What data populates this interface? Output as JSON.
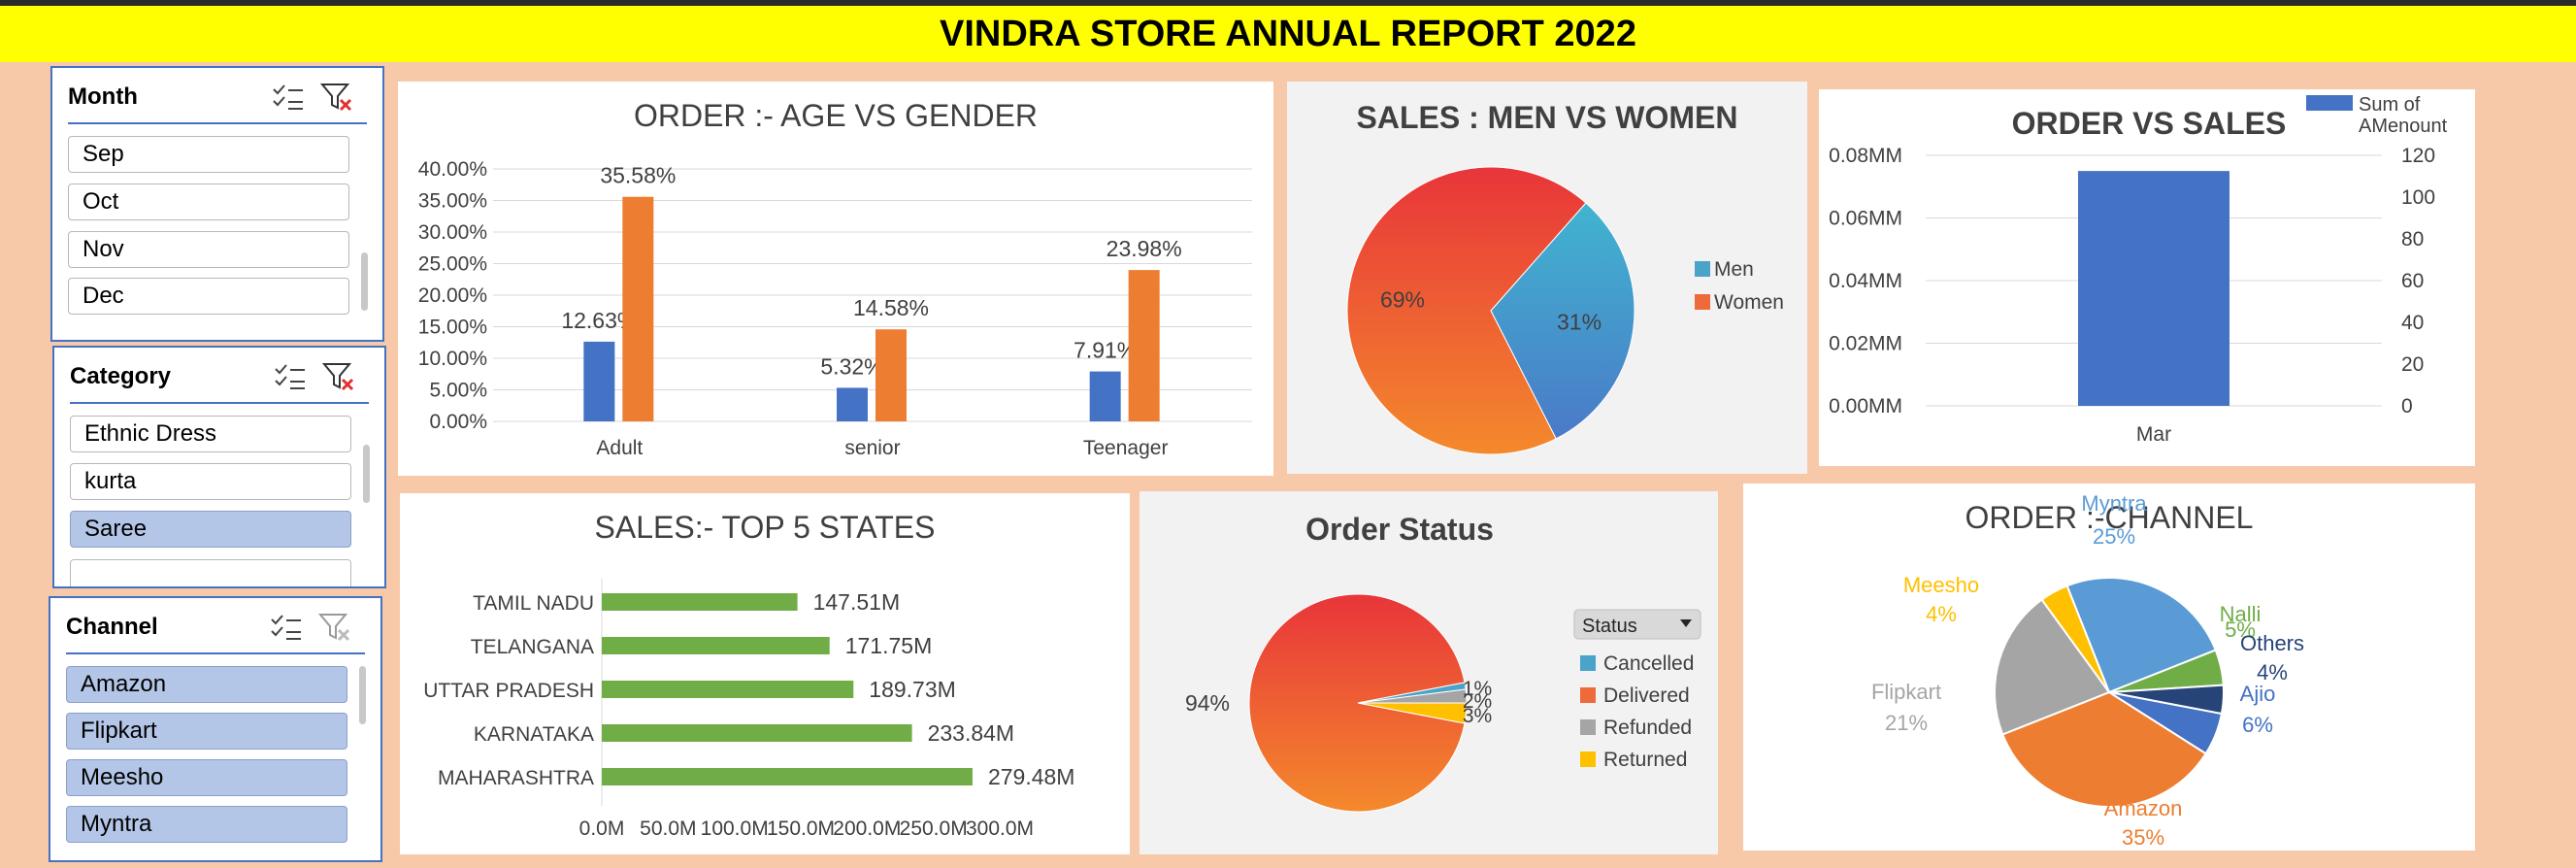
{
  "report": {
    "title": "VINDRA STORE ANNUAL REPORT 2022"
  },
  "slicers": {
    "month": {
      "title": "Month",
      "items": [
        {
          "label": "Sep",
          "selected": false
        },
        {
          "label": "Oct",
          "selected": false
        },
        {
          "label": "Nov",
          "selected": false
        },
        {
          "label": "Dec",
          "selected": false
        }
      ]
    },
    "category": {
      "title": "Category",
      "items": [
        {
          "label": "Ethnic Dress",
          "selected": false
        },
        {
          "label": "kurta",
          "selected": false
        },
        {
          "label": "Saree",
          "selected": true
        }
      ]
    },
    "channel": {
      "title": "Channel",
      "items": [
        {
          "label": "Amazon",
          "selected": true
        },
        {
          "label": "Flipkart",
          "selected": true
        },
        {
          "label": "Meesho",
          "selected": true
        },
        {
          "label": "Myntra",
          "selected": true
        }
      ]
    }
  },
  "icons": {
    "multiselect": "multi-select-icon",
    "clear_filter": "clear-filter-icon"
  },
  "colors": {
    "blue": "#4472c4",
    "orange": "#ed7d31",
    "green": "#70ad47",
    "grey": "#a5a5a5",
    "yellow": "#ffc000",
    "banner": "#ffff00",
    "background": "#f7c9a8"
  },
  "chart_data": [
    {
      "id": "age_gender",
      "type": "bar",
      "title": "ORDER :- AGE VS GENDER",
      "categories": [
        "Adult",
        "senior",
        "Teenager"
      ],
      "series": [
        {
          "values": [
            12.63,
            5.32,
            7.91
          ],
          "labels": [
            "12.63%",
            "5.32%",
            "7.91%"
          ],
          "color": "#4472c4"
        },
        {
          "values": [
            35.58,
            14.58,
            23.98
          ],
          "labels": [
            "35.58%",
            "14.58%",
            "23.98%"
          ],
          "color": "#ed7d31"
        }
      ],
      "ylim": [
        0,
        40
      ],
      "yticks": [
        "0.00%",
        "5.00%",
        "10.00%",
        "15.00%",
        "20.00%",
        "25.00%",
        "30.00%",
        "35.00%",
        "40.00%"
      ],
      "grid": true
    },
    {
      "id": "men_women",
      "type": "pie",
      "title": "SALES : MEN VS WOMEN",
      "labels": [
        "Men",
        "Women"
      ],
      "values": [
        31,
        69
      ],
      "value_labels": [
        "31%",
        "69%"
      ],
      "colors": [
        "#4aa3c8",
        "#ee6a3a"
      ],
      "legend": "right"
    },
    {
      "id": "order_sales",
      "type": "bar",
      "title": "ORDER VS SALES",
      "categories": [
        "Mar"
      ],
      "series": [
        {
          "name": "Sum of AMenount",
          "values": [
            0.075
          ],
          "color": "#4472c4"
        }
      ],
      "legend_lines": [
        "Sum of",
        "AMenount"
      ],
      "yticks": [
        "0.00MM",
        "0.02MM",
        "0.04MM",
        "0.06MM",
        "0.08MM"
      ],
      "ylim": [
        0,
        0.08
      ],
      "y2ticks": [
        "0",
        "20",
        "40",
        "60",
        "80",
        "100",
        "120"
      ],
      "y2lim": [
        0,
        120
      ],
      "legend": "top-right"
    },
    {
      "id": "top_states",
      "type": "bar",
      "orientation": "horizontal",
      "title": "SALES:- TOP 5 STATES",
      "categories": [
        "TAMIL NADU",
        "TELANGANA",
        "UTTAR PRADESH",
        "KARNATAKA",
        "MAHARASHTRA"
      ],
      "values": [
        147.51,
        171.75,
        189.73,
        233.84,
        279.48
      ],
      "value_labels": [
        "147.51M",
        "171.75M",
        "189.73M",
        "233.84M",
        "279.48M"
      ],
      "color": "#70ad47",
      "xlim": [
        0,
        300
      ],
      "xticks": [
        "0.0M",
        "50.0M",
        "100.0M",
        "150.0M",
        "200.0M",
        "250.0M",
        "300.0M"
      ]
    },
    {
      "id": "order_status",
      "type": "pie",
      "title": "Order  Status",
      "legend_title": "Status",
      "labels": [
        "Cancelled",
        "Delivered",
        "Refunded",
        "Returned"
      ],
      "values": [
        1,
        94,
        2,
        3
      ],
      "value_labels": [
        "1%",
        "94%",
        "2%",
        "3%"
      ],
      "colors": [
        "#4aa3c8",
        "#ee6a3a",
        "#a5a5a5",
        "#ffc000"
      ],
      "legend": "right"
    },
    {
      "id": "channel",
      "type": "pie",
      "title": "ORDER :-CHANNEL",
      "labels": [
        "Myntra",
        "Nalli",
        "Others",
        "Ajio",
        "Amazon",
        "Flipkart",
        "Meesho"
      ],
      "values": [
        25,
        5,
        4,
        6,
        35,
        21,
        4
      ],
      "value_labels": [
        "25%",
        "5%",
        "4%",
        "6%",
        "35%",
        "21%",
        "4%"
      ],
      "colors": [
        "#5b9bd5",
        "#70ad47",
        "#264478",
        "#4472c4",
        "#ed7d31",
        "#a5a5a5",
        "#ffc000"
      ]
    }
  ]
}
